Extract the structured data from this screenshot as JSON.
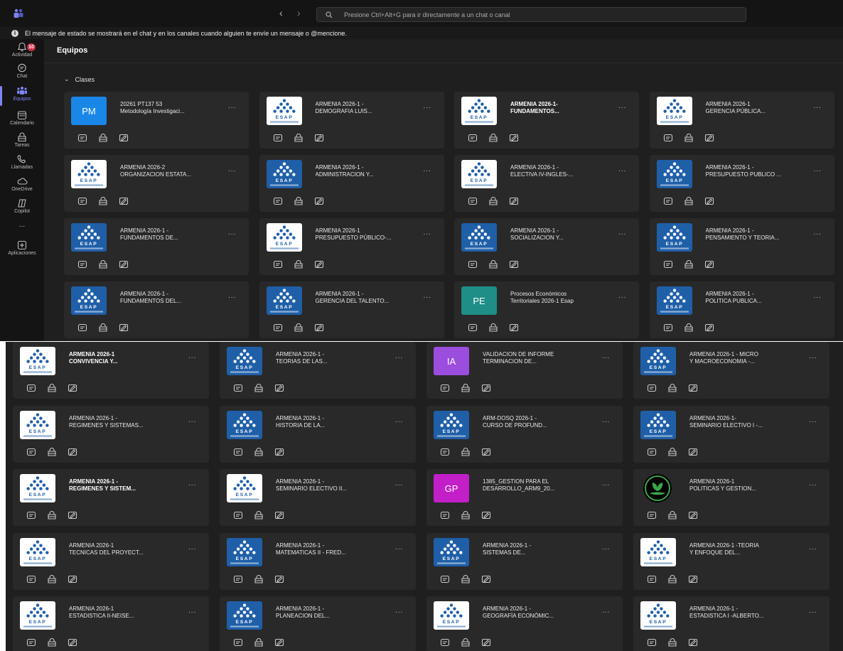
{
  "search": {
    "placeholder": "Presione Ctrl+Alt+G para ir directamente a un chat o canal"
  },
  "banner": {
    "text": "El mensaje de estado se mostrará en el chat y en los canales cuando alguien te envíe un mensaje o @mencione."
  },
  "rail": {
    "badge": "10",
    "items": [
      {
        "label": "Actividad",
        "icon": "bell-icon"
      },
      {
        "label": "Chat",
        "icon": "chat-icon"
      },
      {
        "label": "Equipos",
        "icon": "teams-icon",
        "active": true
      },
      {
        "label": "Calendario",
        "icon": "calendar-icon"
      },
      {
        "label": "Tareas",
        "icon": "tasks-icon"
      },
      {
        "label": "Llamadas",
        "icon": "phone-icon"
      },
      {
        "label": "OneDrive",
        "icon": "cloud-icon"
      },
      {
        "label": "Copilot",
        "icon": "copilot-icon"
      },
      {
        "label": "...",
        "icon": "more-icon"
      },
      {
        "label": "Aplicaciones",
        "icon": "apps-icon"
      }
    ]
  },
  "page": {
    "title": "Equipos",
    "section": "Clases"
  },
  "colors": {
    "accent": "#7f85f5",
    "badge": "#c4314b",
    "pm": "#1a86e8",
    "pe": "#1e8e86",
    "ia": "#9b4dde",
    "gp": "#c21fc9"
  },
  "top_cards": [
    {
      "name": "20261 PT137 53\nMetodología Investigaci...",
      "thumb": "initials",
      "initials": "PM",
      "bg": "#1a86e8",
      "bold": false
    },
    {
      "name": "ARMENIA 2026-1 -\nDEMOGRAFIA LUIS...",
      "thumb": "logo",
      "bold": false
    },
    {
      "name": "ARMENIA 2026-1-\nFUNDAMENTOS...",
      "thumb": "logo",
      "bold": true
    },
    {
      "name": "ARMENIA 2026-1\nGERENCIA PÚBLICA...",
      "thumb": "logo",
      "bold": false
    },
    {
      "name": "ARMENIA 2026-2\nORGANIZACION ESTATA...",
      "thumb": "logo",
      "bold": false
    },
    {
      "name": "ARMENIA 2026-1 -\nADMINISTRACION Y...",
      "thumb": "logo-blue",
      "bold": false
    },
    {
      "name": "ARMENIA 2026-1 -\nELECTIVA IV-INGLES-...",
      "thumb": "logo",
      "bold": false
    },
    {
      "name": "ARMENIA 2026-1 -\nPRESUPUESTO PUBLICO ...",
      "thumb": "logo-blue",
      "bold": false
    },
    {
      "name": "ARMENIA 2026-1 -\nFUNDAMENTOS DE...",
      "thumb": "logo-blue",
      "bold": false
    },
    {
      "name": "ARMENIA 2026-1\nPRESUPUESTO PÚBLICO-...",
      "thumb": "logo",
      "bold": false
    },
    {
      "name": "ARMENIA 2026-1 -\nSOCIALIZACION Y...",
      "thumb": "logo-blue",
      "bold": false
    },
    {
      "name": "ARMENIA 2026-1 -\nPENSAMIENTO Y TEORIA...",
      "thumb": "logo-blue",
      "bold": false
    },
    {
      "name": "ARMENIA 2026-1 -\nFUNDAMENTOS DEL...",
      "thumb": "logo-blue",
      "bold": false
    },
    {
      "name": "ARMENIA 2026-1 -\nGERENCIA DEL TALENTO...",
      "thumb": "logo-blue",
      "bold": false
    },
    {
      "name": "Procesos Económicos\nTerritoriales 2026-1 Esap",
      "thumb": "initials",
      "initials": "PE",
      "bg": "#1e8e86",
      "bold": false
    },
    {
      "name": "ARMENIA 2026-1 -\nPOLITICA PUBLICA...",
      "thumb": "logo-blue",
      "bold": false
    }
  ],
  "bottom_cards": [
    {
      "name": "ARMENIA 2026-1\nCONVIVENCIA Y...",
      "thumb": "logo",
      "bold": true
    },
    {
      "name": "ARMENIA 2026-1 -\nTEORIAS DE LAS...",
      "thumb": "logo-blue",
      "bold": false
    },
    {
      "name": "VALIDACION DE INFORME\nTERMINACION DE...",
      "thumb": "initials",
      "initials": "IA",
      "bg": "#9b4dde",
      "bold": false
    },
    {
      "name": "ARMENIA 2026-1 - MICRO\nY MACROECONOMIA -...",
      "thumb": "logo-blue",
      "bold": false
    },
    {
      "name": "ARMENIA 2026-1 -\nREGIMENES Y SISTEMAS...",
      "thumb": "logo",
      "bold": false
    },
    {
      "name": "ARMENIA 2026-1 -\nHISTORIA DE LA...",
      "thumb": "logo-blue",
      "bold": false
    },
    {
      "name": "ARM-DOSQ 2026-1 -\nCURSO DE PROFUND...",
      "thumb": "logo-blue",
      "bold": false
    },
    {
      "name": "ARMENIA 2026-1-\nSEMINARIO ELECTIVO I -...",
      "thumb": "logo-blue",
      "bold": false
    },
    {
      "name": "ARMENIA 2026-1 -\nREGIMENES Y SISTEM...",
      "thumb": "logo",
      "bold": true
    },
    {
      "name": "ARMENIA 2026-1 -\nSEMINARIO ELECTIVO II...",
      "thumb": "logo",
      "bold": false
    },
    {
      "name": "1385_GESTION PARA EL\nDESARROLLO_ARM9_20...",
      "thumb": "initials",
      "initials": "GP",
      "bg": "#c21fc9",
      "bold": false
    },
    {
      "name": "ARMENIA 2026-1\nPOLITICAS Y GESTION...",
      "thumb": "plant",
      "bold": false
    },
    {
      "name": "ARMENIA 2026-1\nTECNICAS DEL PROYECT...",
      "thumb": "logo",
      "bold": false
    },
    {
      "name": "ARMENIA 2026-1 -\nMATEMATICAS II - FRED...",
      "thumb": "logo-blue",
      "bold": false
    },
    {
      "name": "ARMENIA 2026-1 -\nSISTEMAS DE...",
      "thumb": "logo-blue",
      "bold": false
    },
    {
      "name": "ARMENIA 2026-1 -TEORIA\nY ENFOQUE DEL...",
      "thumb": "logo",
      "bold": false
    },
    {
      "name": "ARMENIA 2026-1\nESTADISTICA II-NEISE...",
      "thumb": "logo",
      "bold": false
    },
    {
      "name": "ARMENIA 2026-1 -\nPLANEACION DEL...",
      "thumb": "logo-blue",
      "bold": false
    },
    {
      "name": "ARMENIA 2026-1 -\nGEOGRAFÍA ECONÓMIC...",
      "thumb": "logo",
      "bold": false
    },
    {
      "name": "ARMENIA 2026-1 -\nESTADISTICA I -ALBERTO...",
      "thumb": "logo",
      "bold": false
    }
  ],
  "card_more": "...",
  "card_icons": [
    "posts-icon",
    "class-notebook-icon",
    "assignments-icon"
  ]
}
